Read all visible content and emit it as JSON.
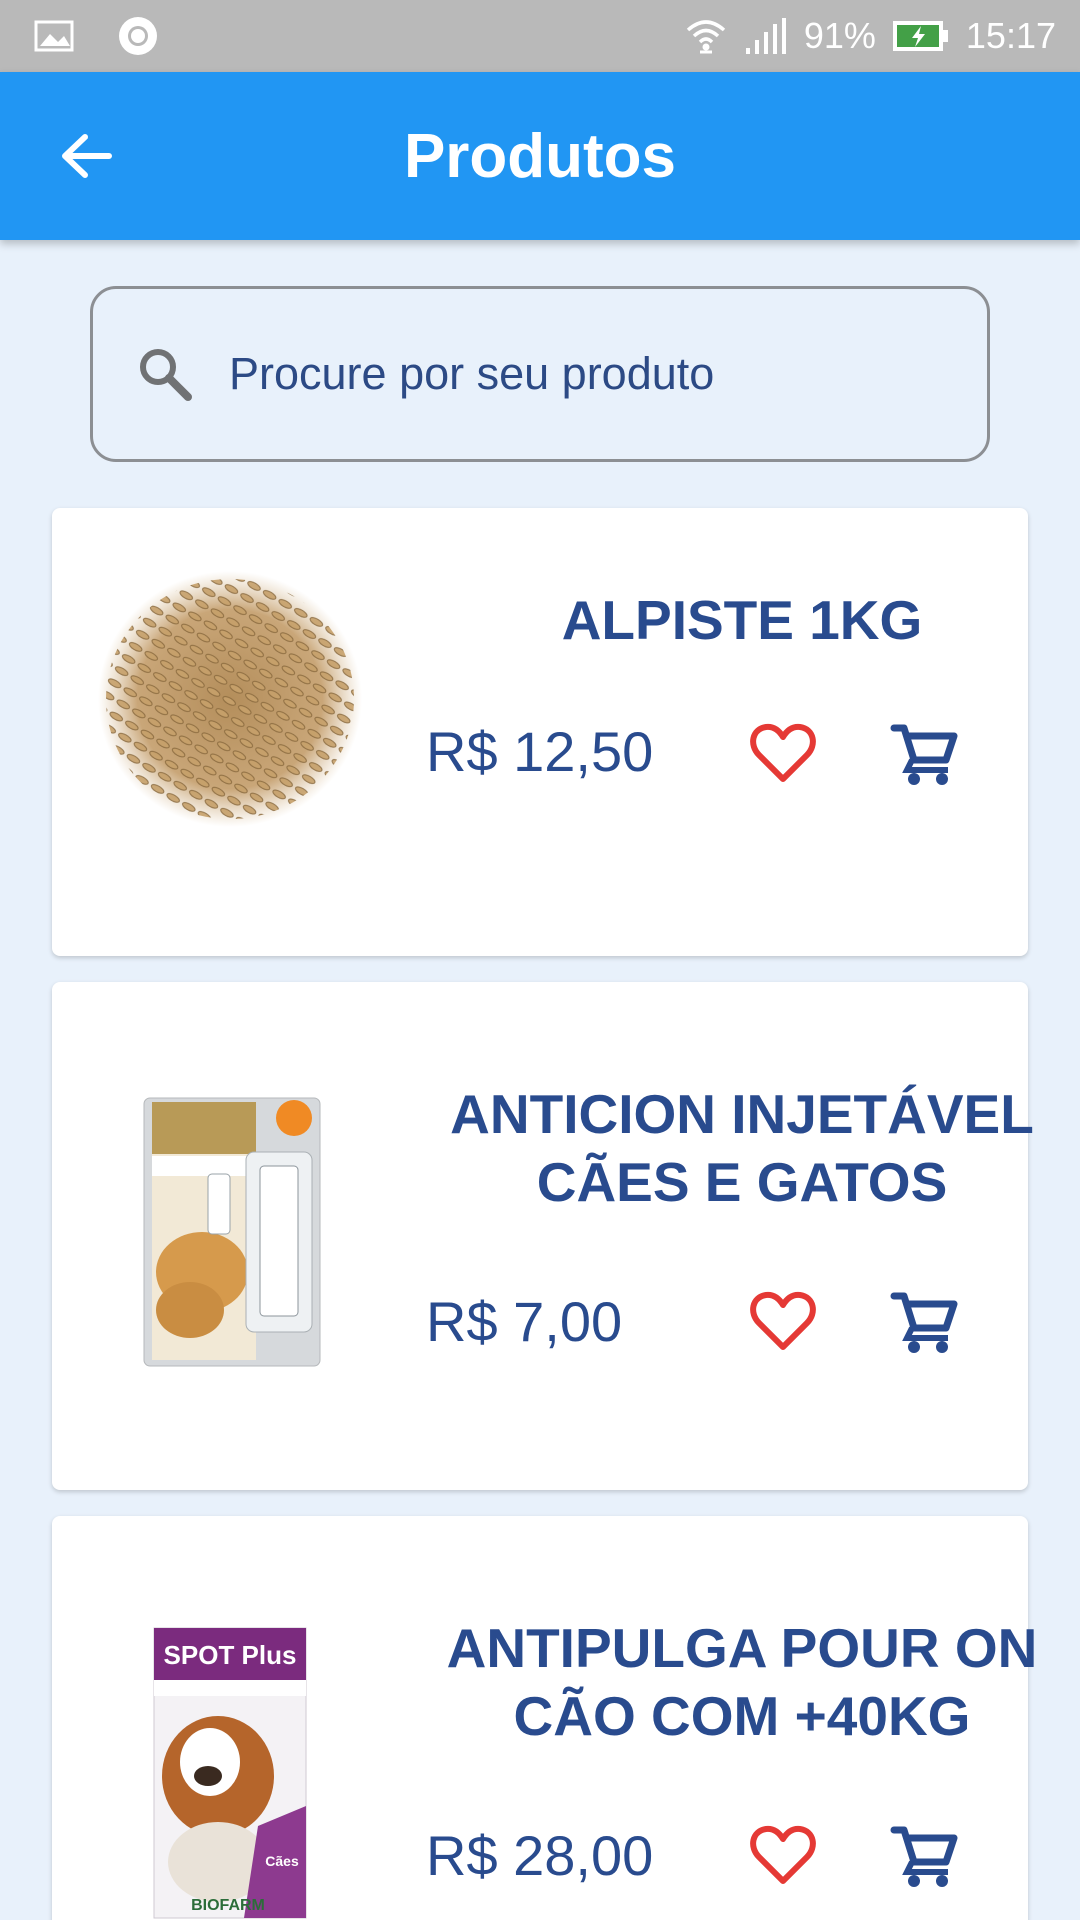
{
  "status_bar": {
    "battery_percent": "91%",
    "time": "15:17",
    "icons": [
      "image-icon",
      "record-icon",
      "wifi-icon",
      "signal-icon",
      "battery-charging-icon"
    ]
  },
  "app_bar": {
    "title": "Produtos",
    "back_icon": "arrow-left-icon",
    "color": "#2196f3"
  },
  "search": {
    "placeholder": "Procure por seu produto",
    "icon": "search-icon"
  },
  "colors": {
    "text_primary": "#294b8e",
    "favorite": "#e53935",
    "background": "#e8f1fb"
  },
  "products": [
    {
      "name": "ALPISTE 1KG",
      "price": "R$ 12,50",
      "image": "birdseed-image"
    },
    {
      "name": "ANTICION INJETÁVEL CÃES E GATOS",
      "price": "R$ 7,00",
      "image": "anticion-box-image"
    },
    {
      "name": "ANTIPULGA POUR ON CÃO COM +40KG",
      "price": "R$ 28,00",
      "image": "spot-plus-box-image",
      "image_text": [
        "SPOT Plus",
        "Cães",
        "BIOFARM"
      ]
    }
  ]
}
